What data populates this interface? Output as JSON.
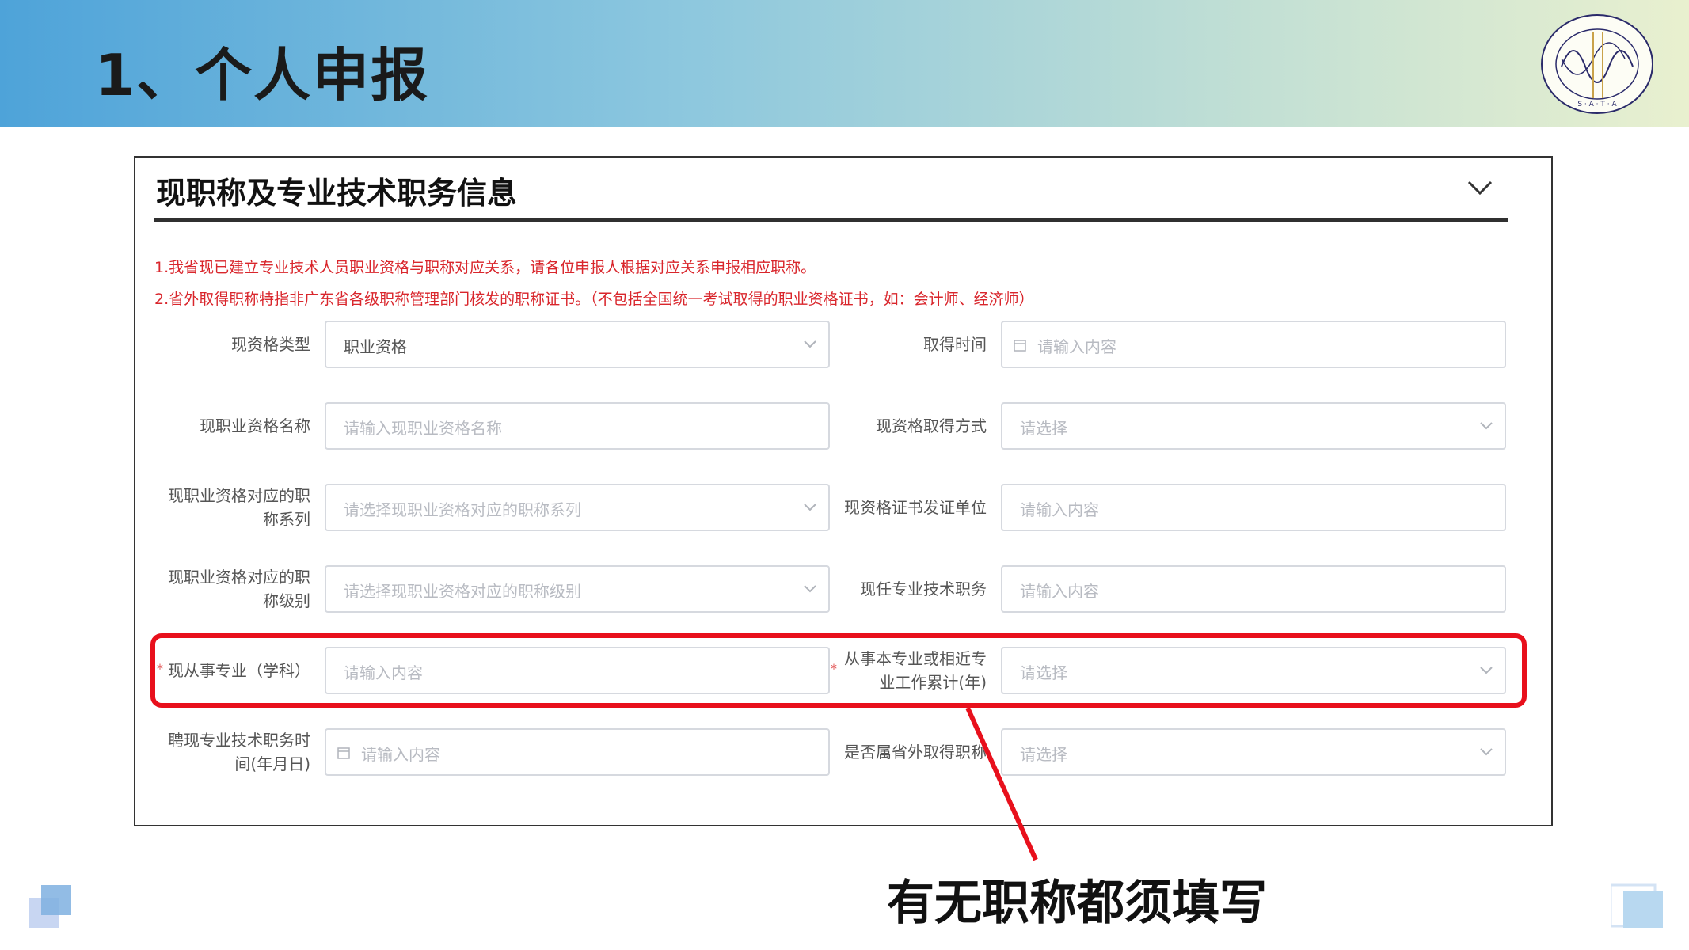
{
  "slide": {
    "title": "1、个人申报"
  },
  "logo": {
    "text": "SHENZHEN ASSOCIATION OF TESTERS AND ANALYSIS",
    "abbr": "S · A · T · A"
  },
  "panel": {
    "title": "现职称及专业技术职务信息",
    "collapse_icon": "chevron-down-icon",
    "notices": [
      "1.我省现已建立专业技术人员职业资格与职称对应关系，请各位申报人根据对应关系申报相应职称。",
      "2.省外取得职称特指非广东省各级职称管理部门核发的职称证书。（不包括全国统一考试取得的职业资格证书，如：会计师、经济师）"
    ]
  },
  "form": {
    "rows": [
      {
        "left": {
          "label": "现资格类型",
          "value": "职业资格",
          "placeholder": "",
          "control": "select"
        },
        "right": {
          "label": "取得时间",
          "value": "",
          "placeholder": "请输入内容",
          "control": "date"
        }
      },
      {
        "left": {
          "label": "现职业资格名称",
          "value": "",
          "placeholder": "请输入现职业资格名称",
          "control": "text"
        },
        "right": {
          "label": "现资格取得方式",
          "value": "",
          "placeholder": "请选择",
          "control": "select"
        }
      },
      {
        "left": {
          "label": "现职业资格对应的职称系列",
          "value": "",
          "placeholder": "请选择现职业资格对应的职称系列",
          "control": "select"
        },
        "right": {
          "label": "现资格证书发证单位",
          "value": "",
          "placeholder": "请输入内容",
          "control": "text"
        }
      },
      {
        "left": {
          "label": "现职业资格对应的职称级别",
          "value": "",
          "placeholder": "请选择现职业资格对应的职称级别",
          "control": "select"
        },
        "right": {
          "label": "现任专业技术职务",
          "value": "",
          "placeholder": "请输入内容",
          "control": "text"
        }
      },
      {
        "left": {
          "label": "现从事专业（学科）",
          "value": "",
          "placeholder": "请输入内容",
          "control": "text",
          "required": true
        },
        "right": {
          "label": "从事本专业或相近专业工作累计(年)",
          "value": "",
          "placeholder": "请选择",
          "control": "select",
          "required": true
        }
      },
      {
        "left": {
          "label": "聘现专业技术职务时间(年月日)",
          "value": "",
          "placeholder": "请输入内容",
          "control": "date"
        },
        "right": {
          "label": "是否属省外取得职称",
          "value": "",
          "placeholder": "请选择",
          "control": "select"
        }
      }
    ],
    "required_mark": "*"
  },
  "annotation": {
    "callout": "有无职称都须填写",
    "highlight_color": "#e8101c"
  },
  "colors": {
    "notice_red": "#d9262c",
    "banner_start": "#4ea3d9",
    "banner_end": "#e9f0cf",
    "border": "#d6d9df",
    "placeholder": "#b8bbc2"
  }
}
